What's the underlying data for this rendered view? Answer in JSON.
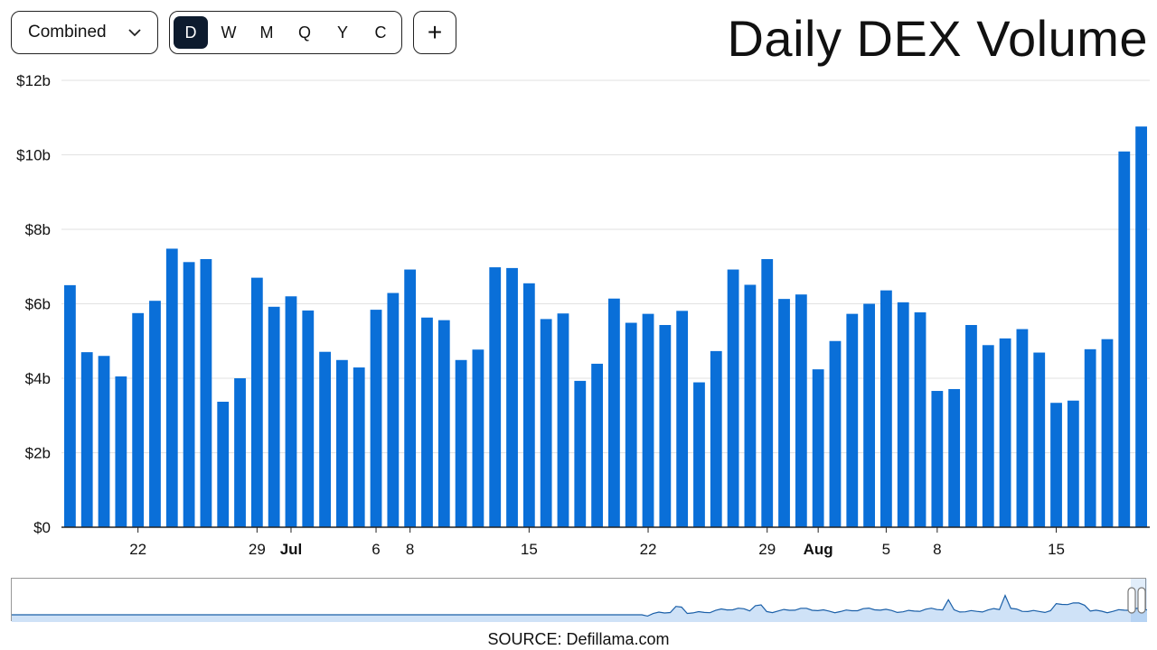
{
  "toolbar": {
    "chain_select": {
      "value": "Combined"
    },
    "periods": [
      "D",
      "W",
      "M",
      "Q",
      "Y",
      "C"
    ],
    "active_period": "D",
    "add_label": "+"
  },
  "title": "Daily DEX Volume",
  "source": "SOURCE: Defillama.com",
  "colors": {
    "bar": "#0a6fd8",
    "grid": "#e2e2e2",
    "brush_fill": "#cfe2f7",
    "brush_line": "#1a5fa8"
  },
  "chart_data": {
    "type": "bar",
    "title": "Daily DEX Volume",
    "ylim": [
      0,
      12
    ],
    "y_ticks": [
      "$0",
      "$2b",
      "$4b",
      "$6b",
      "$8b",
      "$10b",
      "$12b"
    ],
    "y_unit": "billion USD",
    "grid": true,
    "x_tick_labels": [
      {
        "i": 4,
        "label": "22",
        "bold": false
      },
      {
        "i": 11,
        "label": "29",
        "bold": false
      },
      {
        "i": 13,
        "label": "Jul",
        "bold": true
      },
      {
        "i": 18,
        "label": "6",
        "bold": false
      },
      {
        "i": 20,
        "label": "8",
        "bold": false
      },
      {
        "i": 27,
        "label": "15",
        "bold": false
      },
      {
        "i": 34,
        "label": "22",
        "bold": false
      },
      {
        "i": 41,
        "label": "29",
        "bold": false
      },
      {
        "i": 44,
        "label": "Aug",
        "bold": true
      },
      {
        "i": 48,
        "label": "5",
        "bold": false
      },
      {
        "i": 51,
        "label": "8",
        "bold": false
      },
      {
        "i": 58,
        "label": "15",
        "bold": false
      }
    ],
    "values": [
      6.5,
      4.7,
      4.6,
      4.05,
      5.75,
      6.08,
      7.48,
      7.12,
      7.2,
      3.37,
      4.0,
      6.7,
      5.92,
      6.2,
      5.82,
      4.71,
      4.49,
      4.29,
      5.84,
      6.29,
      6.92,
      5.63,
      5.56,
      4.49,
      4.77,
      6.98,
      6.96,
      6.55,
      5.59,
      5.74,
      3.93,
      4.39,
      6.14,
      5.49,
      5.73,
      5.43,
      5.81,
      3.89,
      4.73,
      6.92,
      6.51,
      7.2,
      6.13,
      6.25,
      4.24,
      5.0,
      5.73,
      6.0,
      6.36,
      6.04,
      5.77,
      3.66,
      3.71,
      5.43,
      4.89,
      5.07,
      5.32,
      4.69,
      3.34,
      3.4,
      4.78,
      5.05,
      10.09,
      10.76
    ]
  }
}
